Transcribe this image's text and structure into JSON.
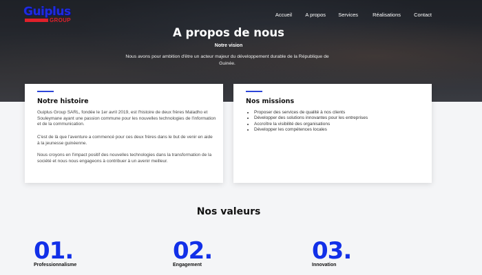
{
  "logo": {
    "main": "Guiplus",
    "sub": "GROUP"
  },
  "nav": {
    "items": [
      {
        "label": "Accueil"
      },
      {
        "label": "A propos"
      },
      {
        "label": "Services"
      },
      {
        "label": "Réalisations"
      },
      {
        "label": "Contact"
      }
    ]
  },
  "hero": {
    "title": "A propos de nous",
    "subtitle": "Notre vision",
    "description": "Nous avons pour ambition d'être un acteur majeur du développement durable de la République de Guinée."
  },
  "story": {
    "title": "Notre histoire",
    "paragraphs": [
      "Guiplus Group SARL, fondée le 1er avril 2019, est l'histoire de deux frères Maladho et Souleymane ayant une passion commune pour les nouvelles technologies de l'information et de la communication.",
      "C'est de là que l'aventure a commencé pour ces deux frères dans le but de venir en aide à la jeunesse guinéenne.",
      "Nous croyons en l'impact positif des nouvelles technologies dans la transformation de la société et nous nous engageons à contribuer à un avenir meilleur."
    ]
  },
  "missions": {
    "title": "Nos missions",
    "items": [
      "Proposer des services de qualité à nos clients",
      "Développer des solutions innovantes pour les entreprises",
      "Accroître la visibilité des organisations",
      "Développer les compétences locales"
    ]
  },
  "values": {
    "title": "Nos valeurs",
    "items": [
      {
        "number": "01.",
        "label": "Professionnalisme"
      },
      {
        "number": "02.",
        "label": "Engagement"
      },
      {
        "number": "03.",
        "label": "Innovation"
      }
    ]
  },
  "colors": {
    "accent": "#1230e8",
    "brand_red": "#e0202a",
    "card_bg": "#ffffff"
  }
}
